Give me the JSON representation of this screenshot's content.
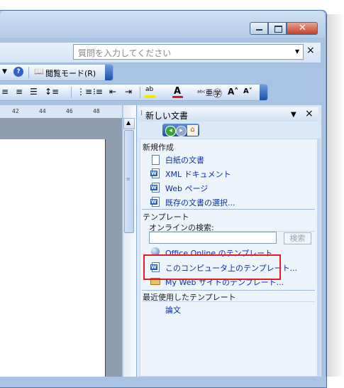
{
  "window": {
    "caption_buttons": [
      "minimize",
      "maximize",
      "close"
    ]
  },
  "menubar": {
    "help_placeholder": "質問を入力してください",
    "help_dropdown_glyph": "▾",
    "close_glyph": "×"
  },
  "toolbar1": {
    "reading_mode_label": "閲覧モード(R)"
  },
  "ruler": {
    "marks": [
      "42",
      "44",
      "46",
      "48"
    ]
  },
  "taskpane": {
    "title": "新しい文書",
    "dropdown_glyph": "▼",
    "close_glyph": "×",
    "new_section": {
      "heading": "新規作成",
      "items": [
        {
          "label": "白紙の文書",
          "icon": "blank-document-icon"
        },
        {
          "label": "XML ドキュメント",
          "icon": "xml-document-icon"
        },
        {
          "label": "Web ページ",
          "icon": "web-page-icon"
        },
        {
          "label": "既存の文書の選択...",
          "icon": "existing-document-icon"
        }
      ]
    },
    "template_section": {
      "heading": "テンプレート",
      "search_label": "オンラインの検索:",
      "search_value": "",
      "search_button": "検索",
      "links": [
        {
          "label": "Office Online のテンプレート",
          "icon": "office-online-icon"
        },
        {
          "label": "このコンピュータ上のテンプレート...",
          "icon": "word-document-icon"
        },
        {
          "label": "My Web サイトのテンプレート...",
          "icon": "web-folder-icon"
        }
      ]
    },
    "recent_section": {
      "heading": "最近使用したテンプレート",
      "items": [
        "論文"
      ]
    }
  },
  "colors": {
    "highlight_border": "#e31b23",
    "link": "#0a2fa8",
    "taskpane_bg": "#dbe8f7"
  }
}
